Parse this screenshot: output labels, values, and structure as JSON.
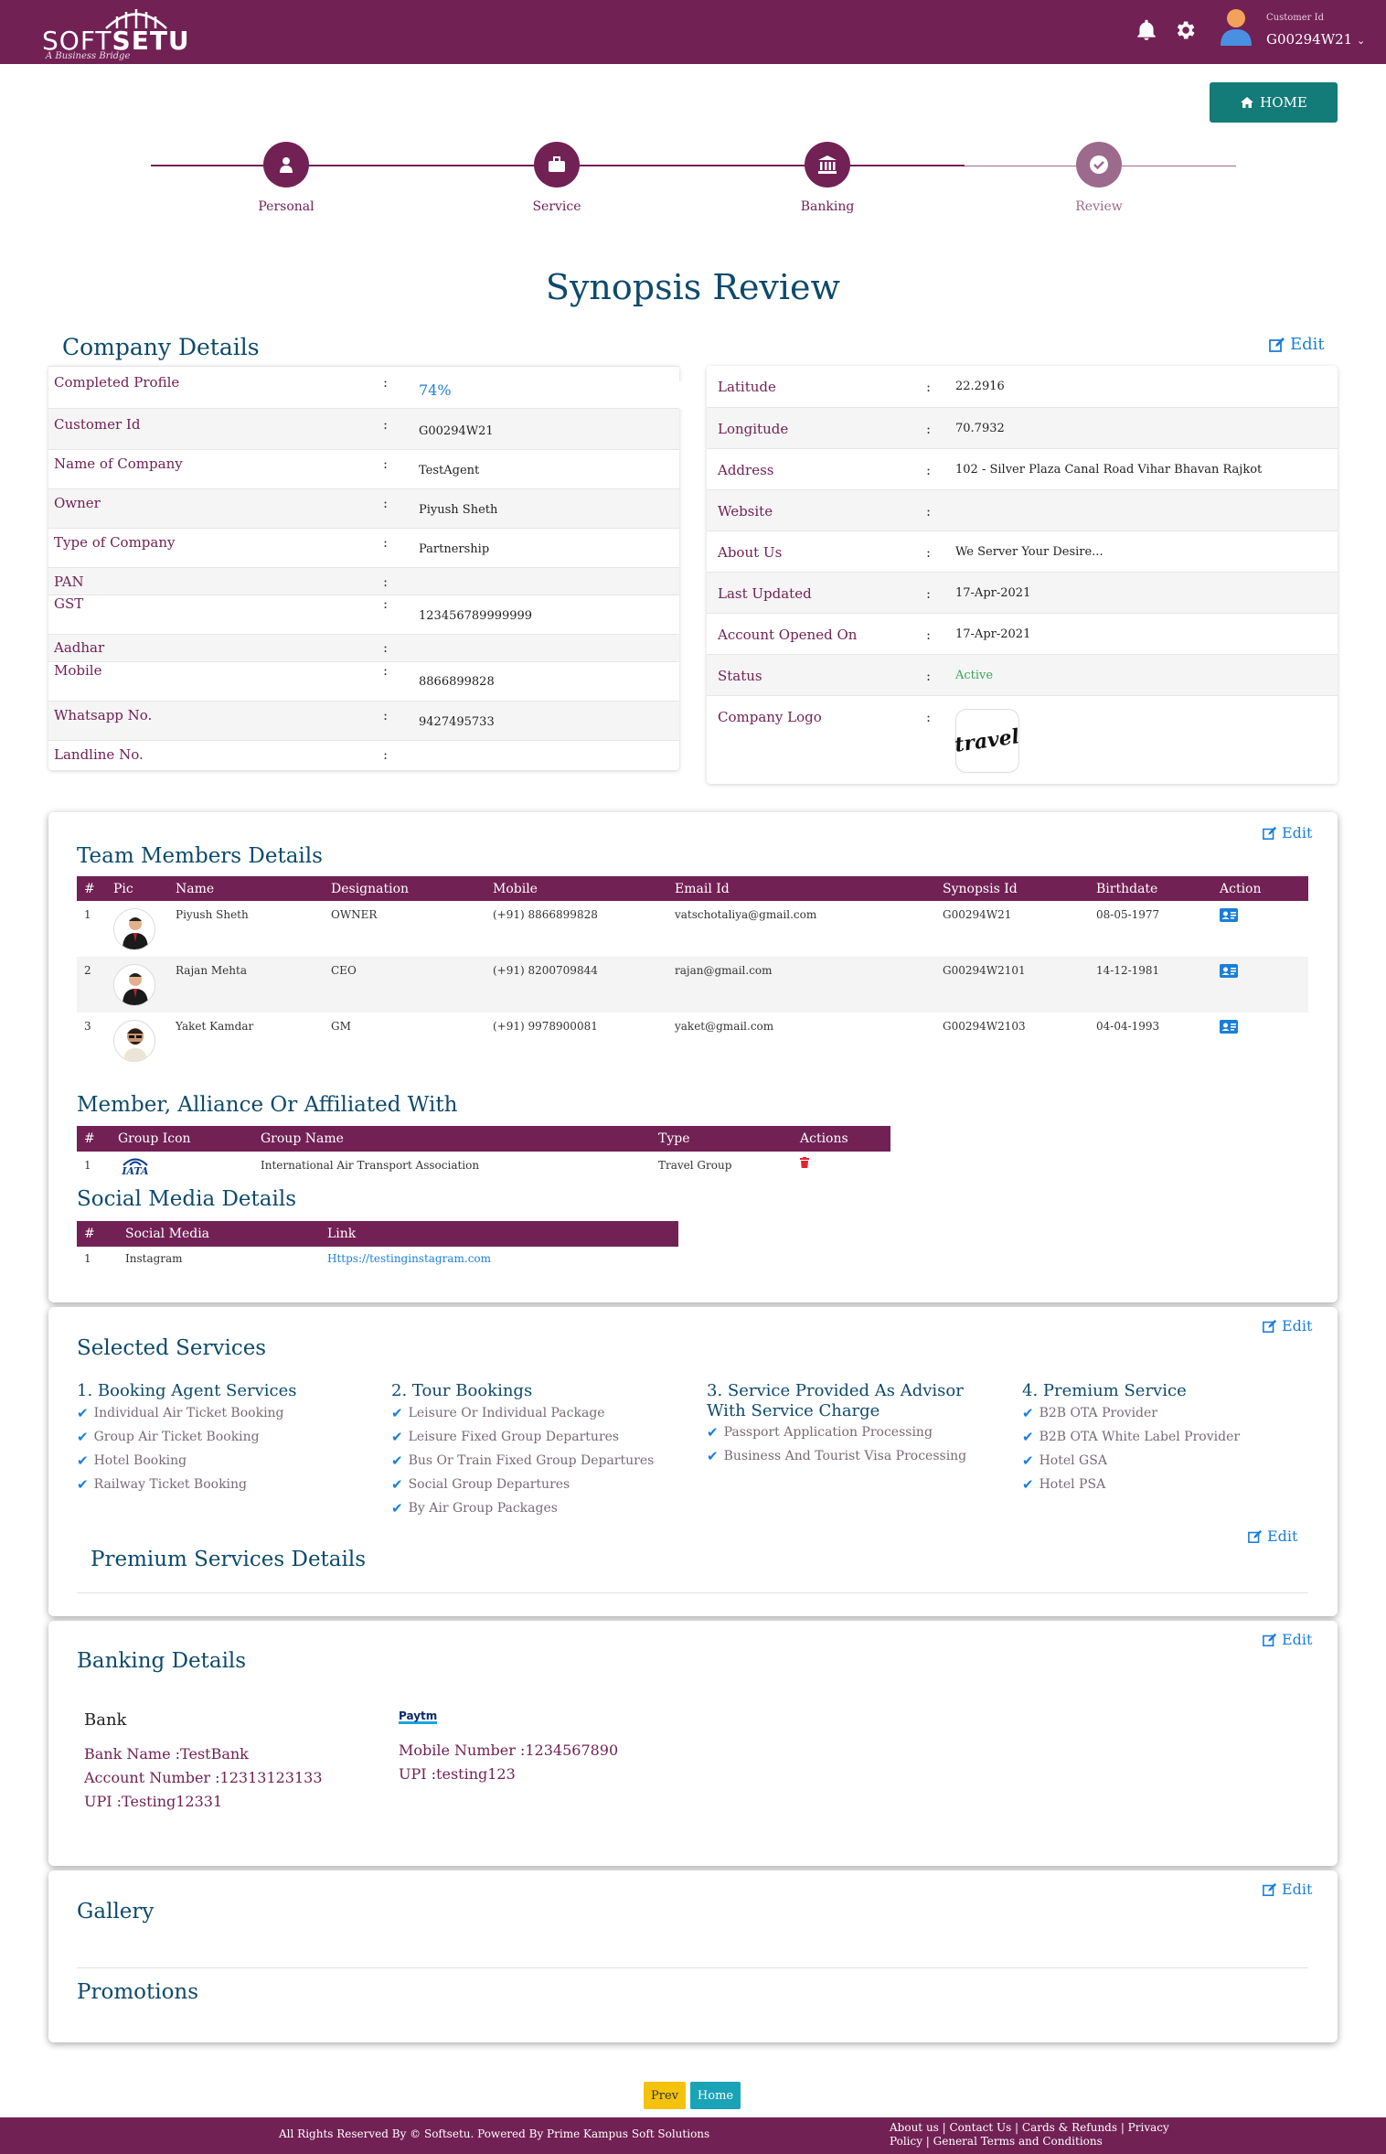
{
  "header": {
    "logo_soft": "SOFT",
    "logo_setu": "SETU",
    "logo_tagline": "A Business Bridge",
    "customer_label": "Customer Id",
    "customer_id": "G00294W21"
  },
  "home_button": "HOME",
  "stepper": {
    "steps": [
      {
        "label": "Personal",
        "icon": "user-icon",
        "state": "done"
      },
      {
        "label": "Service",
        "icon": "briefcase-icon",
        "state": "done"
      },
      {
        "label": "Banking",
        "icon": "bank-icon",
        "state": "done"
      },
      {
        "label": "Review",
        "icon": "check-icon",
        "state": "current"
      }
    ]
  },
  "page_title": "Synopsis Review",
  "edit_label": "Edit",
  "company": {
    "title": "Company Details",
    "left": [
      {
        "key": "Completed Profile",
        "value": "74%"
      },
      {
        "key": "Customer Id",
        "value": "G00294W21"
      },
      {
        "key": "Name of Company",
        "value": "TestAgent"
      },
      {
        "key": "Owner",
        "value": "Piyush Sheth"
      },
      {
        "key": "Type of Company",
        "value": "Partnership"
      },
      {
        "key": "PAN",
        "value": ""
      },
      {
        "key": "GST",
        "value": "123456789999999"
      },
      {
        "key": "Aadhar",
        "value": ""
      },
      {
        "key": "Mobile",
        "value": "8866899828"
      },
      {
        "key": "Whatsapp No.",
        "value": "9427495733"
      },
      {
        "key": "Landline No.",
        "value": ""
      }
    ],
    "right": [
      {
        "key": "Latitude",
        "value": "22.2916"
      },
      {
        "key": "Longitude",
        "value": "70.7932"
      },
      {
        "key": "Address",
        "value": "102 - Silver Plaza Canal Road Vihar Bhavan Rajkot"
      },
      {
        "key": "Website",
        "value": ""
      },
      {
        "key": "About Us",
        "value": "We Server Your Desire..."
      },
      {
        "key": "Last Updated",
        "value": "17-Apr-2021"
      },
      {
        "key": "Account Opened On",
        "value": "17-Apr-2021"
      },
      {
        "key": "Status",
        "value": "Active"
      },
      {
        "key": "Company Logo",
        "value": ""
      }
    ],
    "logo_text": "travel"
  },
  "team": {
    "title": "Team Members Details",
    "headers": [
      "#",
      "Pic",
      "Name",
      "Designation",
      "Mobile",
      "Email Id",
      "Synopsis Id",
      "Birthdate",
      "Action"
    ],
    "rows": [
      {
        "no": "1",
        "name": "Piyush Sheth",
        "designation": "OWNER",
        "mobile": "(+91) 8866899828",
        "email": "vatschotaliya@gmail.com",
        "synopsis": "G00294W21",
        "birthdate": "08-05-1977"
      },
      {
        "no": "2",
        "name": "Rajan Mehta",
        "designation": "CEO",
        "mobile": "(+91) 8200709844",
        "email": "rajan@gmail.com",
        "synopsis": "G00294W2101",
        "birthdate": "14-12-1981"
      },
      {
        "no": "3",
        "name": "Yaket Kamdar",
        "designation": "GM",
        "mobile": "(+91) 9978900081",
        "email": "yaket@gmail.com",
        "synopsis": "G00294W2103",
        "birthdate": "04-04-1993"
      }
    ]
  },
  "alliance": {
    "title": "Member, Alliance Or Affiliated With",
    "headers": [
      "#",
      "Group Icon",
      "Group Name",
      "Type",
      "Actions"
    ],
    "rows": [
      {
        "no": "1",
        "icon_text": "IATA",
        "name": "International Air Transport Association",
        "type": "Travel Group"
      }
    ]
  },
  "social": {
    "title": "Social Media Details",
    "headers": [
      "#",
      "Social Media",
      "Link"
    ],
    "rows": [
      {
        "no": "1",
        "media": "Instagram",
        "link": "Https://testinginstagram.com"
      }
    ]
  },
  "services": {
    "title": "Selected Services",
    "columns": [
      {
        "title": "1. Booking Agent Services",
        "items": [
          "Individual Air Ticket Booking",
          "Group Air Ticket Booking",
          "Hotel Booking",
          "Railway Ticket Booking"
        ]
      },
      {
        "title": "2. Tour Bookings",
        "items": [
          "Leisure Or Individual Package",
          "Leisure Fixed Group Departures",
          "Bus Or Train Fixed Group Departures",
          "Social Group Departures",
          "By Air Group Packages"
        ]
      },
      {
        "title": "3. Service Provided As Advisor With Service Charge",
        "items": [
          "Passport Application Processing",
          "Business And Tourist Visa Processing"
        ]
      },
      {
        "title": "4. Premium Service",
        "items": [
          "B2B OTA Provider",
          "B2B OTA White Label Provider",
          "Hotel GSA",
          "Hotel PSA"
        ]
      }
    ],
    "premium_title": "Premium Services Details"
  },
  "banking": {
    "title": "Banking Details",
    "bank_heading": "Bank",
    "bank_name": "Bank Name :TestBank",
    "account_number": "Account Number :12313123133",
    "upi": "UPI :Testing12331",
    "paytm_logo": "Paytm",
    "paytm_mobile": "Mobile Number :1234567890",
    "paytm_upi": "UPI :testing123"
  },
  "gallery": {
    "title": "Gallery",
    "promotions_title": "Promotions"
  },
  "buttons": {
    "prev": "Prev",
    "home": "Home"
  },
  "footer": {
    "copyright": "All Rights Reserved By © Softsetu. Powered By Prime Kampus Soft Solutions",
    "links_line1": "About us | Contact Us | Cards & Refunds | Privacy",
    "links_line2": "Policy | General Terms and Conditions"
  },
  "colors": {
    "brand": "#722155",
    "title": "#0d4a6b",
    "link": "#1b7fd8",
    "teal": "#137b78",
    "status_active": "#3aa757"
  }
}
